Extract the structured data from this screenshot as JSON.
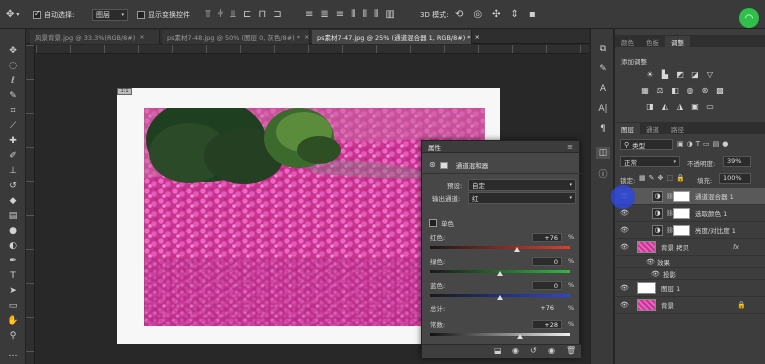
{
  "options_bar": {
    "auto_select_label": "自动选择:",
    "auto_select_value": "图层",
    "show_transform_label": "显示变换控件",
    "mode_3d_label": "3D 模式:"
  },
  "tabs": [
    {
      "label": "风景背景.jpg @ 33.3%(RGB/8#)"
    },
    {
      "label": "ps素材7-48.jpg @ 50% (图层 0, 灰色/8#) *"
    },
    {
      "label": "ps素材7-47.jpg @ 25% (通道混合器 1, RGB/8#) *"
    }
  ],
  "doc_tag": "1:1",
  "properties": {
    "panel_title": "属性",
    "adjustment_name": "通道混和器",
    "preset_label": "预设:",
    "preset_value": "自定",
    "output_channel_label": "输出通道:",
    "output_channel_value": "红",
    "monochrome_label": "单色",
    "sliders": [
      {
        "label": "红色:",
        "value": "+76",
        "unit": "%",
        "fraction": 0.62,
        "from": "#1a1a1a",
        "to": "#e23b2b"
      },
      {
        "label": "绿色:",
        "value": "0",
        "unit": "%",
        "fraction": 0.5,
        "from": "#1a1a1a",
        "to": "#2bbd3a"
      },
      {
        "label": "蓝色:",
        "value": "0",
        "unit": "%",
        "fraction": 0.5,
        "from": "#1a1a1a",
        "to": "#2b46d8"
      }
    ],
    "total_label": "总计:",
    "total_value": "+76",
    "total_unit": "%",
    "constant_label": "常数:",
    "constant_value": "+28",
    "constant_unit": "%",
    "constant_fraction": 0.64
  },
  "right_panel": {
    "top_tabs": [
      "颜色",
      "色板",
      "调整"
    ],
    "adjust_subtitle": "添加调整",
    "layer_tabs": [
      "图层",
      "通道",
      "路径"
    ],
    "filter_label": "类型",
    "blend_mode": "正常",
    "opacity_label": "不透明度:",
    "opacity_value": "39%",
    "lock_label": "锁定:",
    "fill_label": "填充:",
    "fill_value": "100%",
    "layers": [
      {
        "name": "通道混合器 1",
        "kind": "adjustment",
        "selected": true
      },
      {
        "name": "选取颜色 1",
        "kind": "adjustment",
        "selected": false
      },
      {
        "name": "亮度/对比度 1",
        "kind": "adjustment",
        "selected": false
      },
      {
        "name": "背景 拷贝",
        "kind": "image",
        "fx": "fx",
        "selected": false
      },
      {
        "name": "效果",
        "kind": "effects",
        "selected": false
      },
      {
        "name": "投影",
        "kind": "effect-item",
        "selected": false
      },
      {
        "name": "图层 1",
        "kind": "white",
        "selected": false
      },
      {
        "name": "背景",
        "kind": "image-locked",
        "selected": false
      }
    ]
  },
  "colors": {
    "accent_cursor": "#2d46dc",
    "wifi_badge": "#2fbf4a",
    "selected_layer": "#595959"
  }
}
